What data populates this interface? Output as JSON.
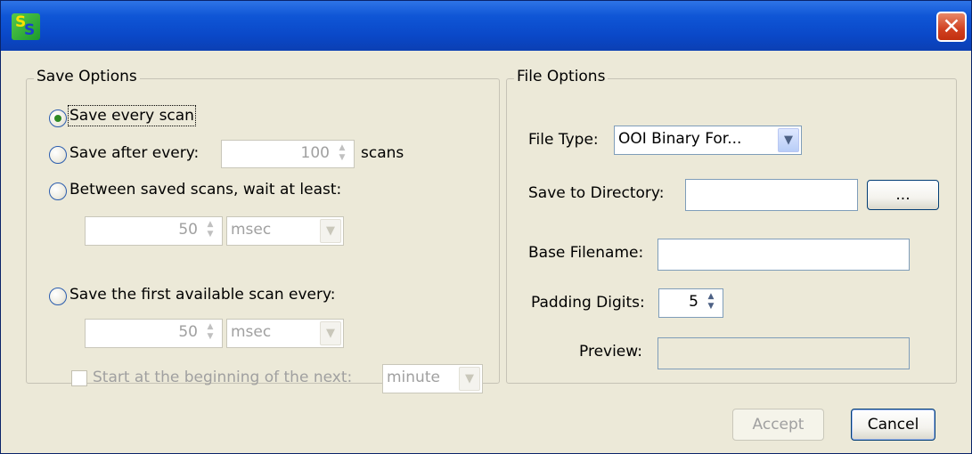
{
  "window": {
    "app_icon_letters": [
      "S",
      "S"
    ],
    "close_glyph": "✕"
  },
  "save_options": {
    "title": "Save Options",
    "option_every_scan": "Save every scan",
    "option_after_every": "Save after every:",
    "after_every_value": "100",
    "after_every_unit": "scans",
    "option_between": "Between saved scans, wait at least:",
    "between_value": "50",
    "between_unit": "msec",
    "option_first_available": "Save the first available scan every:",
    "first_available_value": "50",
    "first_available_unit": "msec",
    "start_next_label": "Start at the beginning of the next:",
    "start_next_value": "minute",
    "selected_option": "Save every scan"
  },
  "file_options": {
    "title": "File Options",
    "file_type_label": "File Type:",
    "file_type_value": "OOI Binary For...",
    "directory_label": "Save to Directory:",
    "directory_value": "",
    "browse_label": "...",
    "base_filename_label": "Base Filename:",
    "base_filename_value": "",
    "padding_label": "Padding Digits:",
    "padding_value": "5",
    "preview_label": "Preview:",
    "preview_value": ""
  },
  "buttons": {
    "accept": "Accept",
    "cancel": "Cancel"
  },
  "icons": {
    "close": "close-icon",
    "spinner": "spinner-arrows-icon",
    "dropdown": "chevron-down-icon"
  }
}
